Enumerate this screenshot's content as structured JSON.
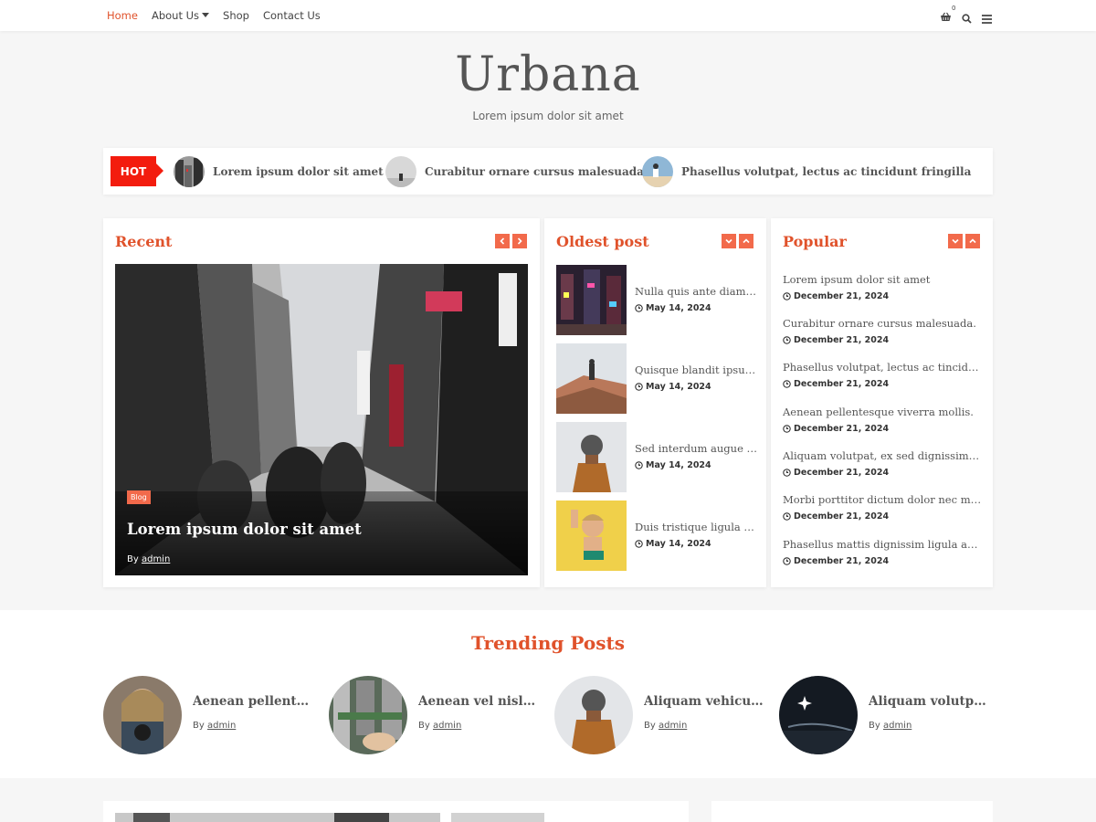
{
  "nav": {
    "items": [
      {
        "label": "Home",
        "active": true
      },
      {
        "label": "About Us",
        "dropdown": true
      },
      {
        "label": "Shop"
      },
      {
        "label": "Contact Us"
      }
    ],
    "cart_count": "0",
    "icons": [
      "cart-icon",
      "search-icon",
      "menu-icon"
    ]
  },
  "header": {
    "title": "Urbana",
    "tagline": "Lorem ipsum dolor sit amet"
  },
  "ticker": {
    "label": "HOT",
    "items": [
      "Lorem ipsum dolor sit amet",
      "Curabitur ornare cursus malesuada.",
      "Phasellus volutpat, lectus ac tincidunt fringilla"
    ]
  },
  "recent": {
    "title": "Recent",
    "hero": {
      "badge": "Blog",
      "title": "Lorem ipsum dolor sit amet",
      "by_prefix": "By ",
      "author": "admin"
    }
  },
  "oldest": {
    "title": "Oldest post",
    "items": [
      {
        "title": "Nulla quis ante diam. Sed",
        "date": "May 14, 2024"
      },
      {
        "title": "Quisque blandit ipsum non",
        "date": "May 14, 2024"
      },
      {
        "title": "Sed interdum augue at nunc",
        "date": "May 14, 2024"
      },
      {
        "title": "Duis tristique ligula a nisl",
        "date": "May 14, 2024"
      }
    ]
  },
  "popular": {
    "title": "Popular",
    "items": [
      {
        "title": "Lorem ipsum dolor sit amet",
        "date": "December 21, 2024"
      },
      {
        "title": "Curabitur ornare cursus malesuada.",
        "date": "December 21, 2024"
      },
      {
        "title": "Phasellus volutpat, lectus ac tincidunt fringilla",
        "date": "December 21, 2024"
      },
      {
        "title": "Aenean pellentesque viverra mollis.",
        "date": "December 21, 2024"
      },
      {
        "title": "Aliquam volutpat, ex sed dignissim commodo",
        "date": "December 21, 2024"
      },
      {
        "title": "Morbi porttitor dictum dolor nec malesuada",
        "date": "December 21, 2024"
      },
      {
        "title": "Phasellus mattis dignissim ligula ac tempus",
        "date": "December 21, 2024"
      }
    ]
  },
  "trending": {
    "title": "Trending Posts",
    "by_prefix": "By ",
    "items": [
      {
        "title": "Aenean pellentesque viverra",
        "author": "admin"
      },
      {
        "title": "Aenean vel nisl vestibulum",
        "author": "admin"
      },
      {
        "title": "Aliquam vehicula justo",
        "author": "admin"
      },
      {
        "title": "Aliquam volutpat, ex sed",
        "author": "admin"
      }
    ]
  },
  "colors": {
    "accent": "#e0522b",
    "button": "#f26a4b",
    "hot": "#f31c0e"
  }
}
